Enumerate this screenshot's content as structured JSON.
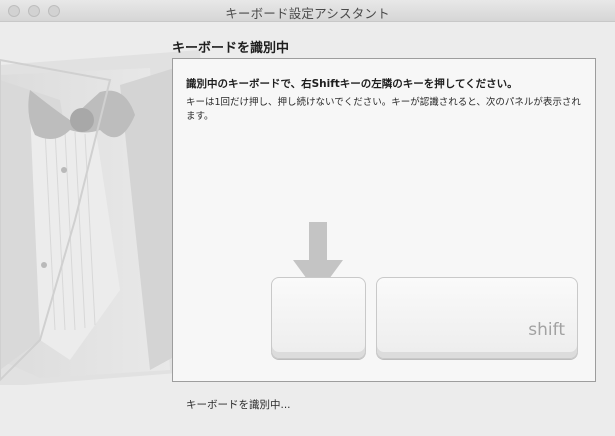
{
  "window": {
    "title": "キーボード設定アシスタント"
  },
  "page": {
    "heading": "キーボードを識別中",
    "instruction": "識別中のキーボードで、右Shiftキーの左隣のキーを押してください。",
    "description": "キーは1回だけ押し、押し続けないでください。キーが認識されると、次のパネルが表示されます。",
    "status": "キーボードを識別中..."
  },
  "keys": {
    "target_key_label": "",
    "shift_key_label": "shift"
  },
  "icons": {
    "arrow": "down-arrow-icon",
    "illustration": "tuxedo-illustration"
  },
  "colors": {
    "window_bg": "#ececec",
    "panel_bg": "#f7f7f7",
    "arrow": "#c4c4c4"
  }
}
